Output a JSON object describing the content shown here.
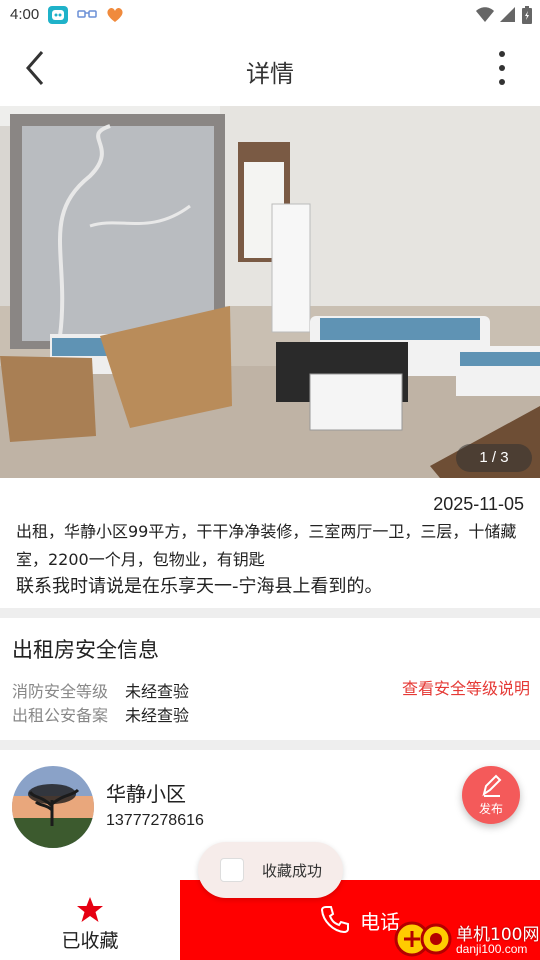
{
  "status_bar": {
    "time": "4:00"
  },
  "app_bar": {
    "title": "详情"
  },
  "gallery": {
    "counter": "1 / 3"
  },
  "listing": {
    "date": "2025-11-05",
    "description": "出租，华静小区99平方，干干净净装修，三室两厅一卫，三层，十储藏室，2200一个月，包物业，有钥匙",
    "contact_note": "联系我时请说是在乐享天一-宁海县上看到的。"
  },
  "safety": {
    "title": "出租房安全信息",
    "rows": [
      {
        "label": "消防安全等级",
        "value": "未经查验"
      },
      {
        "label": "出租公安备案",
        "value": "未经查验"
      }
    ],
    "link": "查看安全等级说明"
  },
  "owner": {
    "name": "华静小区",
    "phone": "13777278616"
  },
  "fab": {
    "label": "发布"
  },
  "toast": {
    "text": "收藏成功"
  },
  "bottom_bar": {
    "favorite_label": "已收藏",
    "call_label": "电话"
  },
  "watermark": {
    "line1": "单机100网",
    "line2": "danji100.com"
  },
  "colors": {
    "accent_red": "#ff0000",
    "link_red": "#e53935",
    "fab_red": "#f45a5a"
  }
}
